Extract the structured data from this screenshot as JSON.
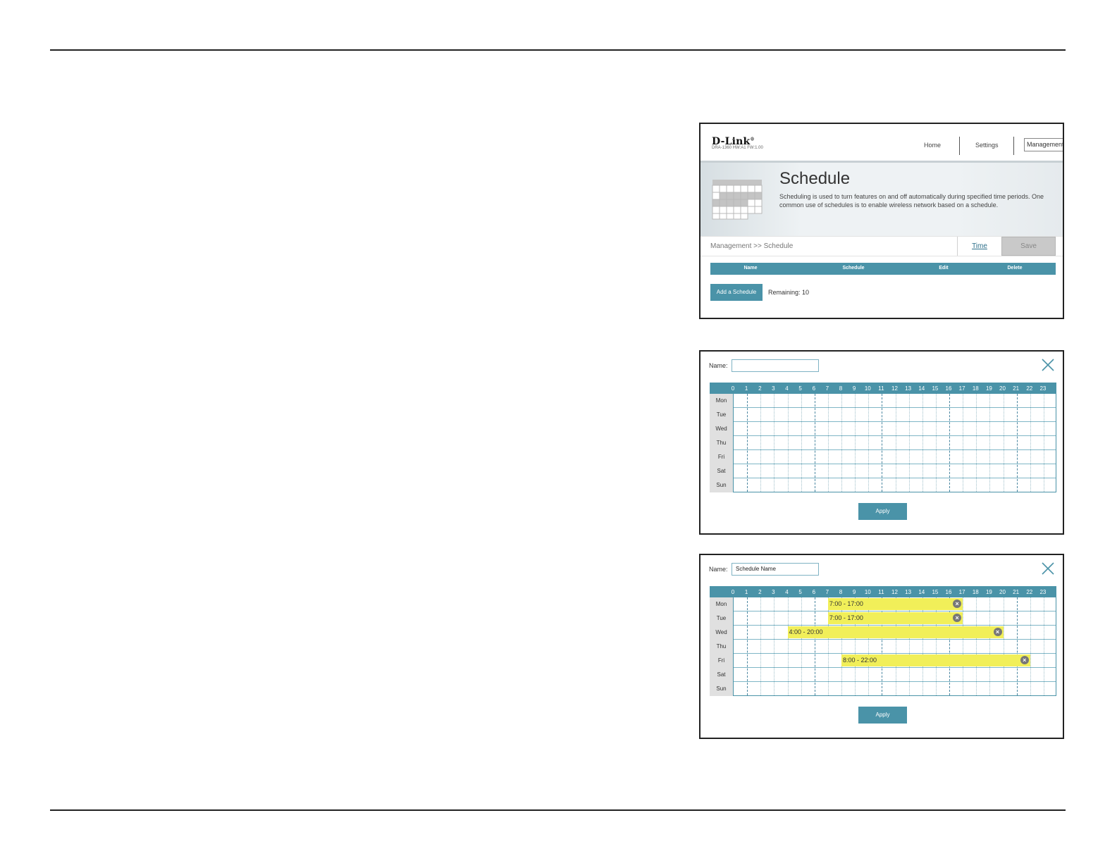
{
  "shot1": {
    "logo": "D-Link",
    "logo_reg": "®",
    "model_line": "DRA-1360   HW:A1   FW:1.00",
    "nav": {
      "home": "Home",
      "settings": "Settings",
      "management": "Management"
    },
    "title": "Schedule",
    "description": "Scheduling is used to turn features on and off automatically during specified time periods. One common use of schedules is to enable wireless network based on a schedule.",
    "breadcrumb": "Management >> Schedule",
    "time_link": "Time",
    "save_label": "Save",
    "table_headers": [
      "Name",
      "Schedule",
      "Edit",
      "Delete"
    ],
    "add_label": "Add a Schedule",
    "remaining": "Remaining: 10"
  },
  "shot2": {
    "name_label": "Name:",
    "name_value": "",
    "hours": [
      "0",
      "1",
      "2",
      "3",
      "4",
      "5",
      "6",
      "7",
      "8",
      "9",
      "10",
      "11",
      "12",
      "13",
      "14",
      "15",
      "16",
      "17",
      "18",
      "19",
      "20",
      "21",
      "22",
      "23"
    ],
    "days": [
      "Mon",
      "Tue",
      "Wed",
      "Thu",
      "Fri",
      "Sat",
      "Sun"
    ],
    "apply_label": "Apply"
  },
  "shot3": {
    "name_label": "Name:",
    "name_value": "Schedule Name",
    "hours": [
      "0",
      "1",
      "2",
      "3",
      "4",
      "5",
      "6",
      "7",
      "8",
      "9",
      "10",
      "11",
      "12",
      "13",
      "14",
      "15",
      "16",
      "17",
      "18",
      "19",
      "20",
      "21",
      "22",
      "23"
    ],
    "days": [
      "Mon",
      "Tue",
      "Wed",
      "Thu",
      "Fri",
      "Sat",
      "Sun"
    ],
    "blocks": [
      {
        "day": "Mon",
        "start": 7,
        "end": 17,
        "label": "7:00 - 17:00"
      },
      {
        "day": "Tue",
        "start": 7,
        "end": 17,
        "label": "7:00 - 17:00"
      },
      {
        "day": "Wed",
        "start": 4,
        "end": 20,
        "label": "4:00 - 20:00"
      },
      {
        "day": "Fri",
        "start": 8,
        "end": 22,
        "label": "8:00 - 22:00"
      }
    ],
    "apply_label": "Apply"
  },
  "colors": {
    "accent": "#4a93a8",
    "block": "#f1ef59",
    "save_disabled": "#c9c9c9"
  }
}
